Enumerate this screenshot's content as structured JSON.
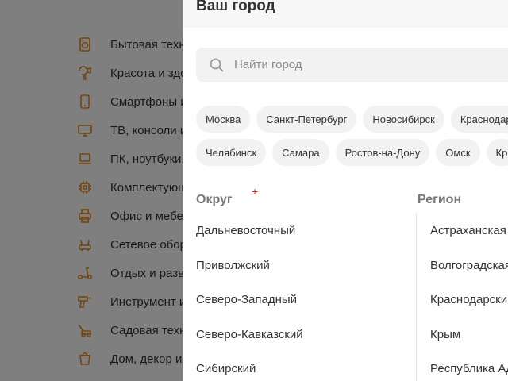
{
  "background": {
    "accent_color": "#e08a1e",
    "categories": [
      {
        "label": "Бытовая техн",
        "icon": "washing-machine-icon"
      },
      {
        "label": "Красота и здо",
        "icon": "hair-dryer-icon"
      },
      {
        "label": "Смартфоны и",
        "icon": "smartphone-icon"
      },
      {
        "label": "ТВ, консоли и",
        "icon": "tv-icon"
      },
      {
        "label": "ПК, ноутбуки,",
        "icon": "laptop-icon"
      },
      {
        "label": "Комплектующ",
        "icon": "cpu-chip-icon"
      },
      {
        "label": "Офис и мебел",
        "icon": "printer-icon"
      },
      {
        "label": "Сетевое обор",
        "icon": "router-icon"
      },
      {
        "label": "Отдых и разв",
        "icon": "scooter-icon"
      },
      {
        "label": "Инструмент и",
        "icon": "drill-icon"
      },
      {
        "label": "Садовая техн",
        "icon": "lawn-mower-icon"
      },
      {
        "label": "Дом, декор и",
        "icon": "bucket-icon"
      }
    ]
  },
  "modal": {
    "title": "Ваш город",
    "search": {
      "placeholder": "Найти город",
      "value": ""
    },
    "popular_cities_row1": [
      "Москва",
      "Санкт-Петербург",
      "Новосибирск",
      "Краснодар"
    ],
    "popular_cities_row2": [
      "Челябинск",
      "Самара",
      "Ростов-на-Дону",
      "Омск",
      "Кр"
    ],
    "districts_heading": "Округ",
    "regions_heading": "Регион",
    "marker": "+",
    "districts": [
      "Дальневосточный",
      "Приволжский",
      "Северо-Западный",
      "Северо-Кавказский",
      "Сибирский"
    ],
    "regions": [
      "Астраханская",
      "Волгоградская",
      "Краснодарский",
      "Крым",
      "Республика Ад"
    ]
  }
}
